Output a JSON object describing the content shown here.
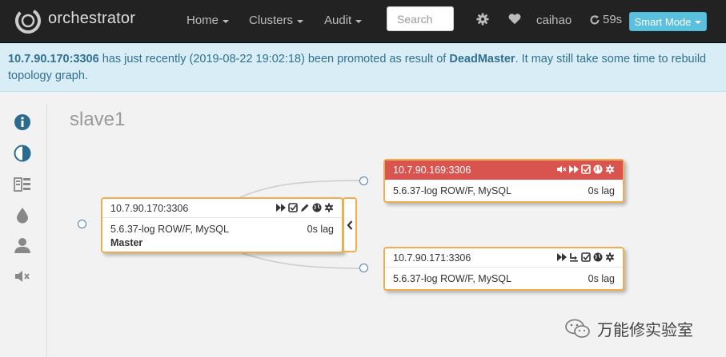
{
  "navbar": {
    "brand": "orchestrator",
    "menu": [
      {
        "label": "Home"
      },
      {
        "label": "Clusters"
      },
      {
        "label": "Audit"
      }
    ],
    "search_placeholder": "Search",
    "user": "caihao",
    "refresh_countdown": "59s",
    "mode_button": "Smart Mode"
  },
  "alert": {
    "host": "10.7.90.170:3306",
    "text1": " has just recently (2019-08-22 19:02:18) been promoted as result of ",
    "reason": "DeadMaster",
    "text2": ". It may still take some time to rebuild topology graph."
  },
  "sidebar": {
    "icons": [
      "info-icon",
      "contrast-icon",
      "dashboard-icon",
      "drop-icon",
      "user-icon",
      "volume-off-icon"
    ]
  },
  "cluster": {
    "title": "slave1",
    "instances": [
      {
        "host": "10.7.90.170:3306",
        "version": "5.6.37-log ROW/F, MySQL",
        "lag": "0s lag",
        "role": "Master",
        "status": "ok"
      },
      {
        "host": "10.7.90.169:3306",
        "version": "5.6.37-log ROW/F, MySQL",
        "lag": "0s lag",
        "status": "problem"
      },
      {
        "host": "10.7.90.171:3306",
        "version": "5.6.37-log ROW/F, MySQL",
        "lag": "0s lag",
        "status": "ok"
      }
    ]
  },
  "watermark": "万能修实验室",
  "colors": {
    "navbar": "#222222",
    "alert_bg": "#d9edf7",
    "alert_text": "#31708f",
    "instance_border": "#f0ad4e",
    "problem_header": "#d9534f",
    "sidebar_icon": "#2c6a8f",
    "mode_button": "#5bc0de"
  }
}
